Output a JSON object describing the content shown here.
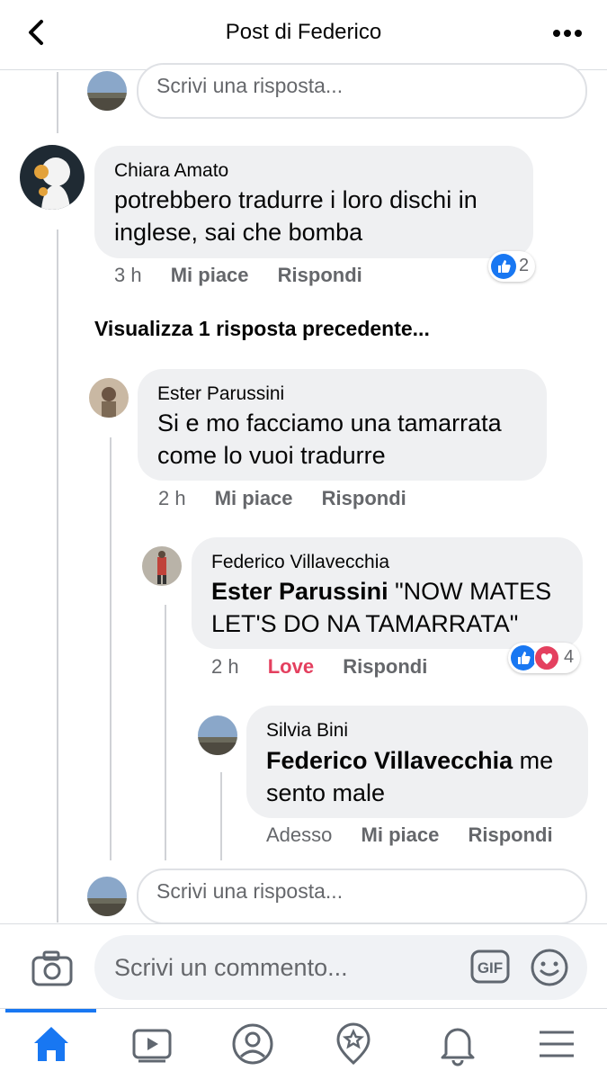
{
  "header": {
    "title": "Post di Federico"
  },
  "reply_placeholder": "Scrivi una risposta...",
  "comments": {
    "chiara": {
      "name": "Chiara Amato",
      "text_line1": "potrebbero tradurre i loro dischi in",
      "text_line2": "inglese, sai che bomba",
      "time": "3 h",
      "like": "Mi piace",
      "reply": "Rispondi",
      "reactions_count": "2"
    },
    "view_previous": "Visualizza 1 risposta precedente...",
    "ester": {
      "name": "Ester Parussini",
      "text_line1": "Si e mo facciamo una tamarrata",
      "text_line2": "come lo vuoi tradurre",
      "time": "2 h",
      "like": "Mi piace",
      "reply": "Rispondi"
    },
    "federico": {
      "name": "Federico Villavecchia",
      "mention": "Ester Parussini",
      "text_line1_rest": " \"NOW MATES",
      "text_line2": "LET'S DO NA TAMARRATA\"",
      "time": "2 h",
      "like": "Love",
      "reply": "Rispondi",
      "reactions_count": "4"
    },
    "silvia": {
      "name": "Silvia Bini",
      "mention": "Federico Villavecchia",
      "text_line1_rest": " me",
      "text_line2": "sento male",
      "time": "Adesso",
      "like": "Mi piace",
      "reply": "Rispondi"
    }
  },
  "composer": {
    "placeholder": "Scrivi un commento...",
    "gif_label": "GIF"
  },
  "tabs": [
    "home-icon",
    "video-icon",
    "profile-icon",
    "pages-icon",
    "notifications-icon",
    "menu-icon"
  ],
  "colors": {
    "accent": "#1877f2",
    "love": "#e4405f",
    "bubble": "#eff0f2",
    "meta": "#65676b"
  }
}
